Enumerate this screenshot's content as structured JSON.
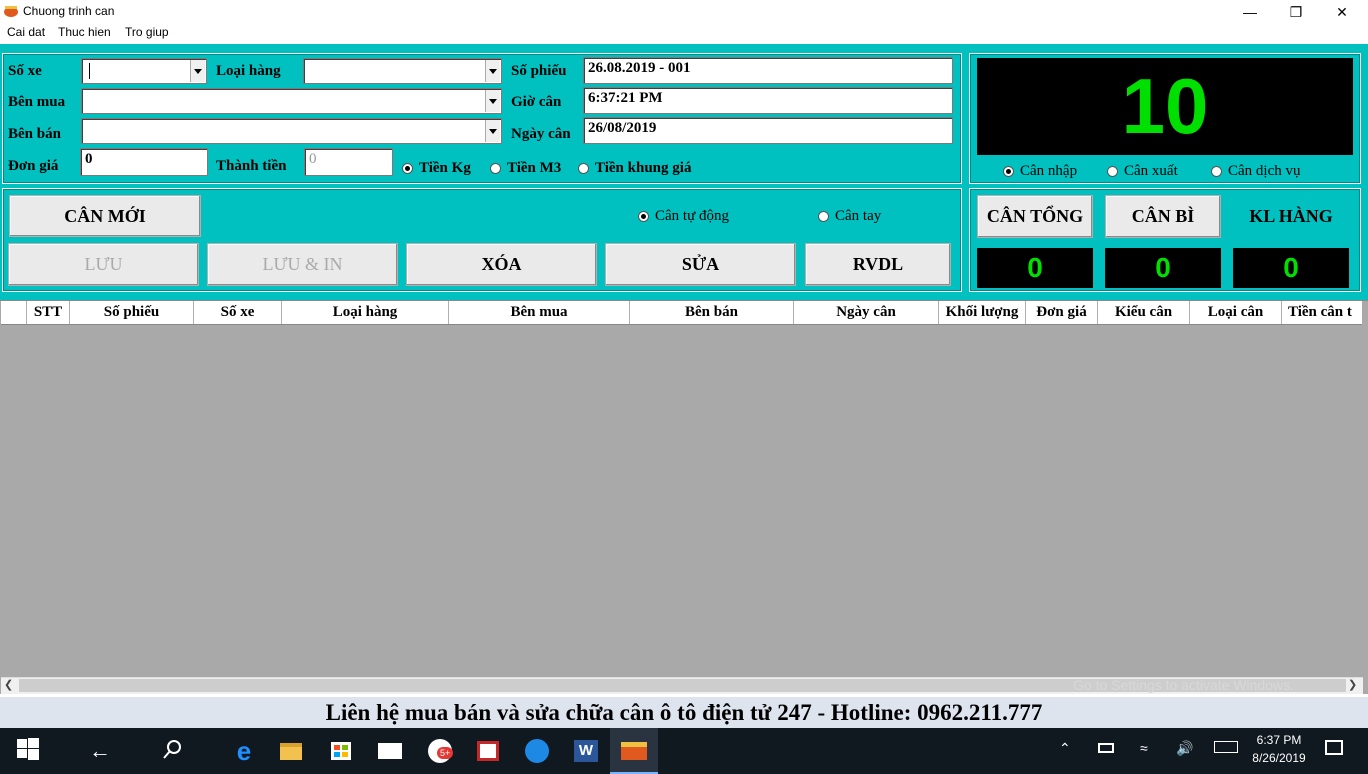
{
  "window": {
    "title": "Chuong trinh can",
    "minimize_glyph": "—",
    "maximize_glyph": "❐",
    "close_glyph": "✕"
  },
  "menu": [
    "Cai dat",
    "Thuc hien",
    "Tro giup"
  ],
  "form": {
    "so_xe_label": "Số xe",
    "so_xe_value": "",
    "loai_hang_label": "Loại hàng",
    "loai_hang_value": "",
    "ben_mua_label": "Bên mua",
    "ben_mua_value": "",
    "ben_ban_label": "Bên bán",
    "ben_ban_value": "",
    "don_gia_label": "Đơn giá",
    "don_gia_value": "0",
    "thanh_tien_label": "Thành tiền",
    "thanh_tien_value": "0",
    "so_phieu_label": "Số phiếu",
    "so_phieu_value": "26.08.2019 - 001",
    "gio_can_label": "Giờ cân",
    "gio_can_value": "6:37:21 PM",
    "ngay_can_label": "Ngày cân",
    "ngay_can_value": "26/08/2019",
    "price_modes": [
      {
        "label": "Tiền Kg",
        "selected": true
      },
      {
        "label": "Tiền M3",
        "selected": false
      },
      {
        "label": "Tiền khung giá",
        "selected": false
      }
    ]
  },
  "actions": {
    "can_moi": "CÂN MỚI",
    "luu": "LƯU",
    "luu_in": "LƯU & IN",
    "xoa": "XÓA",
    "sua": "SỬA",
    "rvdl": "RVDL",
    "auto_mode": {
      "label": "Cân tự động",
      "selected": true
    },
    "manual_mode": {
      "label": "Cân tay",
      "selected": false
    }
  },
  "scale": {
    "reading": "10",
    "weigh_types": [
      {
        "label": "Cân nhập",
        "selected": true
      },
      {
        "label": "Cân xuất",
        "selected": false
      },
      {
        "label": "Cân dịch vụ",
        "selected": false
      }
    ],
    "can_tong_label": "CÂN TỔNG",
    "can_bi_label": "CÂN BÌ",
    "kl_hang_label": "KL HÀNG",
    "can_tong_value": "0",
    "can_bi_value": "0",
    "kl_hang_value": "0"
  },
  "table": {
    "columns": [
      "STT",
      "Số phiếu",
      "Số xe",
      "Loại hàng",
      "Bên mua",
      "Bên bán",
      "Ngày cân",
      "Khối lượng",
      "Đơn giá",
      "Kiểu cân",
      "Loại cân",
      "Tiền cân t"
    ],
    "rows": []
  },
  "watermark": "Go to Settings to activate Windows.",
  "footer_text": "Liên hệ mua bán và sửa chữa cân ô tô điện tử  247 - Hotline: 0962.211.777",
  "taskbar": {
    "time": "6:37 PM",
    "date": "8/26/2019",
    "badge": "5+"
  },
  "colors": {
    "panel": "#00c0c0",
    "display_bg": "#000000",
    "display_fg": "#00e000",
    "grid_bg": "#a9a9a9",
    "taskbar": "#101820"
  }
}
